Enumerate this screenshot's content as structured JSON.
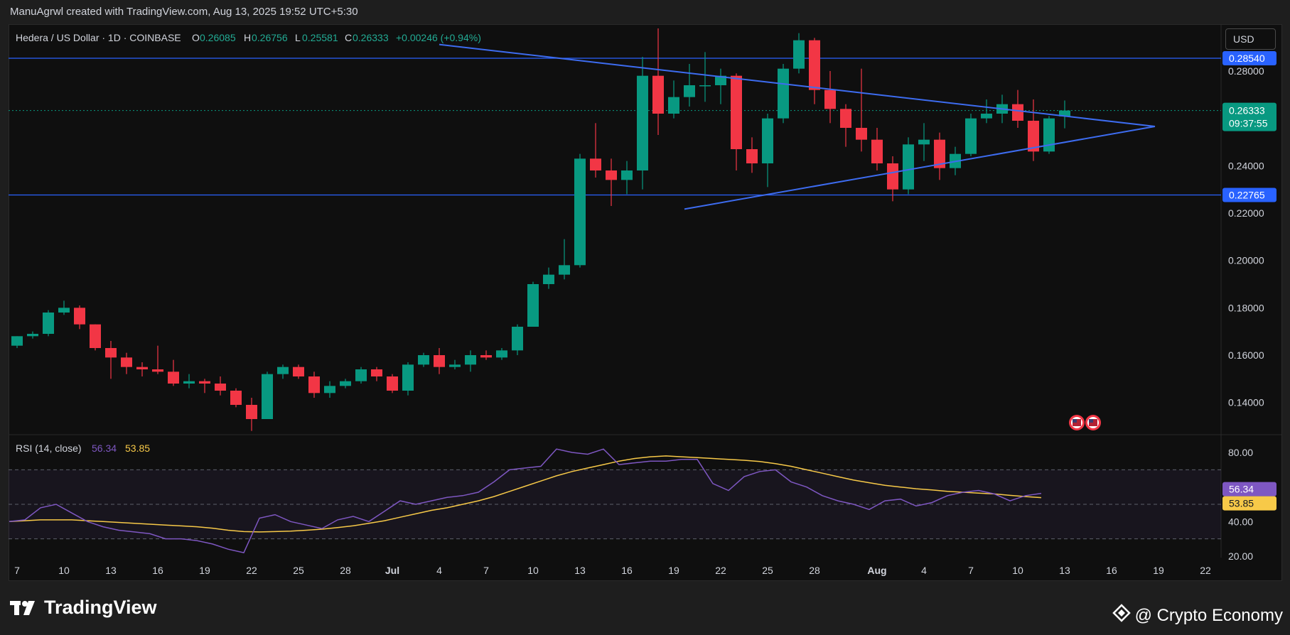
{
  "header": {
    "attribution": "ManuAgrwl created with TradingView.com, Aug 13, 2025 19:52 UTC+5:30"
  },
  "legend": {
    "symbol": "Hedera / US Dollar · 1D · COINBASE",
    "open_label": "O",
    "open": "0.26085",
    "high_label": "H",
    "high": "0.26756",
    "low_label": "L",
    "low": "0.25581",
    "close_label": "C",
    "close": "0.26333",
    "change": "+0.00246 (+0.94%)"
  },
  "price_scale": {
    "currency": "USD",
    "ticks": [
      "0.28000",
      "0.24000",
      "0.22000",
      "0.20000",
      "0.18000",
      "0.16000",
      "0.14000"
    ],
    "tick_values": [
      0.28,
      0.24,
      0.22,
      0.2,
      0.18,
      0.16,
      0.14
    ],
    "resistance_label": "0.28540",
    "current_label": "0.26333",
    "countdown": "09:37:55",
    "support_label": "0.22765"
  },
  "rsi": {
    "title": "RSI (14, close)",
    "value": "56.34",
    "ma_value": "53.85",
    "ticks": [
      "80.00",
      "60.00",
      "40.00",
      "20.00"
    ],
    "tick_values": [
      80,
      60,
      40,
      20
    ]
  },
  "time_axis": {
    "labels": [
      "7",
      "10",
      "13",
      "16",
      "19",
      "22",
      "25",
      "28",
      "Jul",
      "4",
      "7",
      "10",
      "13",
      "16",
      "19",
      "22",
      "25",
      "28",
      "Aug",
      "4",
      "7",
      "10",
      "13",
      "16",
      "19",
      "22"
    ],
    "day_index": [
      0,
      3,
      6,
      9,
      12,
      15,
      18,
      21,
      24,
      27,
      30,
      33,
      36,
      39,
      42,
      45,
      48,
      51,
      55,
      58,
      61,
      64,
      67,
      70,
      73,
      76
    ]
  },
  "footer": {
    "brand": "TradingView",
    "watermark": "@ Crypto Economy"
  },
  "colors": {
    "up": "#089981",
    "down": "#f23645",
    "level_line": "#2962ff",
    "triangle": "#3d6cf0",
    "rsi_line": "#7e57c2",
    "rsi_ma": "#f7c948",
    "current_label_bg": "#089981"
  },
  "chart_data": {
    "type": "candlestick",
    "title": "Hedera / US Dollar · 1D · COINBASE",
    "timeframe": "1D",
    "start_date": "2025-06-07",
    "y_range": [
      0.127,
      0.298
    ],
    "levels": {
      "resistance": 0.2854,
      "support": 0.22765,
      "current": 0.26333
    },
    "triangle": {
      "upper": [
        [
          27,
          0.2912
        ],
        [
          51,
          0.2566
        ]
      ],
      "lower": [
        [
          45,
          0.2217
        ],
        [
          51,
          0.2566
        ]
      ]
    },
    "candles": [
      {
        "o": 0.164,
        "h": 0.168,
        "l": 0.163,
        "c": 0.168
      },
      {
        "o": 0.168,
        "h": 0.17,
        "l": 0.167,
        "c": 0.169
      },
      {
        "o": 0.169,
        "h": 0.179,
        "l": 0.168,
        "c": 0.178
      },
      {
        "o": 0.178,
        "h": 0.183,
        "l": 0.177,
        "c": 0.18
      },
      {
        "o": 0.18,
        "h": 0.181,
        "l": 0.171,
        "c": 0.173
      },
      {
        "o": 0.173,
        "h": 0.173,
        "l": 0.162,
        "c": 0.163
      },
      {
        "o": 0.163,
        "h": 0.166,
        "l": 0.15,
        "c": 0.159
      },
      {
        "o": 0.159,
        "h": 0.161,
        "l": 0.152,
        "c": 0.155
      },
      {
        "o": 0.155,
        "h": 0.157,
        "l": 0.151,
        "c": 0.154
      },
      {
        "o": 0.154,
        "h": 0.164,
        "l": 0.152,
        "c": 0.153
      },
      {
        "o": 0.153,
        "h": 0.158,
        "l": 0.147,
        "c": 0.148
      },
      {
        "o": 0.148,
        "h": 0.152,
        "l": 0.146,
        "c": 0.149
      },
      {
        "o": 0.149,
        "h": 0.15,
        "l": 0.144,
        "c": 0.148
      },
      {
        "o": 0.148,
        "h": 0.151,
        "l": 0.143,
        "c": 0.145
      },
      {
        "o": 0.145,
        "h": 0.146,
        "l": 0.138,
        "c": 0.139
      },
      {
        "o": 0.139,
        "h": 0.142,
        "l": 0.128,
        "c": 0.133
      },
      {
        "o": 0.133,
        "h": 0.153,
        "l": 0.133,
        "c": 0.152
      },
      {
        "o": 0.152,
        "h": 0.156,
        "l": 0.15,
        "c": 0.155
      },
      {
        "o": 0.155,
        "h": 0.156,
        "l": 0.15,
        "c": 0.151
      },
      {
        "o": 0.151,
        "h": 0.153,
        "l": 0.142,
        "c": 0.144
      },
      {
        "o": 0.144,
        "h": 0.149,
        "l": 0.142,
        "c": 0.147
      },
      {
        "o": 0.147,
        "h": 0.15,
        "l": 0.146,
        "c": 0.149
      },
      {
        "o": 0.149,
        "h": 0.155,
        "l": 0.148,
        "c": 0.154
      },
      {
        "o": 0.154,
        "h": 0.155,
        "l": 0.149,
        "c": 0.151
      },
      {
        "o": 0.151,
        "h": 0.152,
        "l": 0.144,
        "c": 0.145
      },
      {
        "o": 0.145,
        "h": 0.157,
        "l": 0.143,
        "c": 0.156
      },
      {
        "o": 0.156,
        "h": 0.161,
        "l": 0.155,
        "c": 0.16
      },
      {
        "o": 0.16,
        "h": 0.163,
        "l": 0.152,
        "c": 0.155
      },
      {
        "o": 0.155,
        "h": 0.158,
        "l": 0.154,
        "c": 0.156
      },
      {
        "o": 0.156,
        "h": 0.162,
        "l": 0.153,
        "c": 0.16
      },
      {
        "o": 0.16,
        "h": 0.162,
        "l": 0.158,
        "c": 0.159
      },
      {
        "o": 0.159,
        "h": 0.163,
        "l": 0.158,
        "c": 0.162
      },
      {
        "o": 0.162,
        "h": 0.173,
        "l": 0.16,
        "c": 0.172
      },
      {
        "o": 0.172,
        "h": 0.191,
        "l": 0.172,
        "c": 0.19
      },
      {
        "o": 0.19,
        "h": 0.197,
        "l": 0.188,
        "c": 0.194
      },
      {
        "o": 0.194,
        "h": 0.209,
        "l": 0.192,
        "c": 0.198
      },
      {
        "o": 0.198,
        "h": 0.245,
        "l": 0.197,
        "c": 0.243
      },
      {
        "o": 0.243,
        "h": 0.258,
        "l": 0.235,
        "c": 0.238
      },
      {
        "o": 0.238,
        "h": 0.243,
        "l": 0.223,
        "c": 0.234
      },
      {
        "o": 0.234,
        "h": 0.242,
        "l": 0.228,
        "c": 0.238
      },
      {
        "o": 0.238,
        "h": 0.286,
        "l": 0.23,
        "c": 0.278
      },
      {
        "o": 0.278,
        "h": 0.298,
        "l": 0.253,
        "c": 0.262
      },
      {
        "o": 0.262,
        "h": 0.276,
        "l": 0.26,
        "c": 0.269
      },
      {
        "o": 0.269,
        "h": 0.283,
        "l": 0.265,
        "c": 0.274
      },
      {
        "o": 0.274,
        "h": 0.288,
        "l": 0.267,
        "c": 0.274
      },
      {
        "o": 0.274,
        "h": 0.281,
        "l": 0.266,
        "c": 0.278
      },
      {
        "o": 0.278,
        "h": 0.279,
        "l": 0.238,
        "c": 0.247
      },
      {
        "o": 0.247,
        "h": 0.252,
        "l": 0.237,
        "c": 0.241
      },
      {
        "o": 0.241,
        "h": 0.262,
        "l": 0.231,
        "c": 0.26
      },
      {
        "o": 0.26,
        "h": 0.283,
        "l": 0.258,
        "c": 0.281
      },
      {
        "o": 0.281,
        "h": 0.296,
        "l": 0.279,
        "c": 0.293
      },
      {
        "o": 0.293,
        "h": 0.294,
        "l": 0.266,
        "c": 0.272
      },
      {
        "o": 0.272,
        "h": 0.28,
        "l": 0.258,
        "c": 0.264
      },
      {
        "o": 0.264,
        "h": 0.266,
        "l": 0.248,
        "c": 0.256
      },
      {
        "o": 0.256,
        "h": 0.281,
        "l": 0.246,
        "c": 0.251
      },
      {
        "o": 0.251,
        "h": 0.256,
        "l": 0.238,
        "c": 0.241
      },
      {
        "o": 0.241,
        "h": 0.244,
        "l": 0.225,
        "c": 0.23
      },
      {
        "o": 0.23,
        "h": 0.252,
        "l": 0.228,
        "c": 0.249
      },
      {
        "o": 0.249,
        "h": 0.258,
        "l": 0.242,
        "c": 0.251
      },
      {
        "o": 0.251,
        "h": 0.254,
        "l": 0.234,
        "c": 0.239
      },
      {
        "o": 0.239,
        "h": 0.248,
        "l": 0.236,
        "c": 0.245
      },
      {
        "o": 0.245,
        "h": 0.262,
        "l": 0.244,
        "c": 0.26
      },
      {
        "o": 0.26,
        "h": 0.268,
        "l": 0.258,
        "c": 0.262
      },
      {
        "o": 0.262,
        "h": 0.27,
        "l": 0.258,
        "c": 0.266
      },
      {
        "o": 0.266,
        "h": 0.272,
        "l": 0.256,
        "c": 0.259
      },
      {
        "o": 0.259,
        "h": 0.268,
        "l": 0.242,
        "c": 0.246
      },
      {
        "o": 0.246,
        "h": 0.261,
        "l": 0.245,
        "c": 0.26
      },
      {
        "o": 0.26085,
        "h": 0.26756,
        "l": 0.25581,
        "c": 0.26333
      }
    ],
    "rsi": {
      "name": "RSI (14, close)",
      "range": [
        13,
        87
      ],
      "bands": [
        70,
        50,
        30
      ],
      "values": [
        40,
        41,
        48,
        50,
        45,
        40,
        37,
        35,
        34,
        33,
        30,
        30,
        29,
        27,
        24,
        22,
        42,
        44,
        40,
        38,
        36,
        41,
        43,
        40,
        46,
        52,
        50,
        52,
        54,
        55,
        57,
        63,
        70,
        71,
        72,
        82,
        80,
        79,
        82,
        73,
        74,
        75,
        75,
        76,
        76,
        62,
        58,
        66,
        69,
        70,
        63,
        60,
        55,
        52,
        50,
        47,
        52,
        53,
        49,
        51,
        55,
        57,
        58,
        56,
        52,
        55,
        56.34
      ],
      "ma": [
        40,
        40.5,
        41,
        41,
        41,
        40.5,
        40,
        39.5,
        39,
        38.5,
        38,
        37.5,
        37,
        36.2,
        35,
        34.2,
        34,
        34.2,
        34.5,
        35,
        35.6,
        36.5,
        37.6,
        39,
        40.5,
        42.5,
        44.5,
        46.5,
        48,
        50,
        52,
        54.5,
        57.5,
        60.5,
        63.5,
        66.5,
        69,
        71,
        73,
        75,
        76.5,
        77.5,
        78,
        77.5,
        77,
        76.5,
        76,
        75.5,
        74.8,
        73.5,
        72,
        70,
        68,
        66,
        64,
        62.5,
        61,
        60,
        59,
        58.3,
        57.5,
        57,
        56.5,
        56,
        55.2,
        54.5,
        53.85
      ]
    }
  }
}
